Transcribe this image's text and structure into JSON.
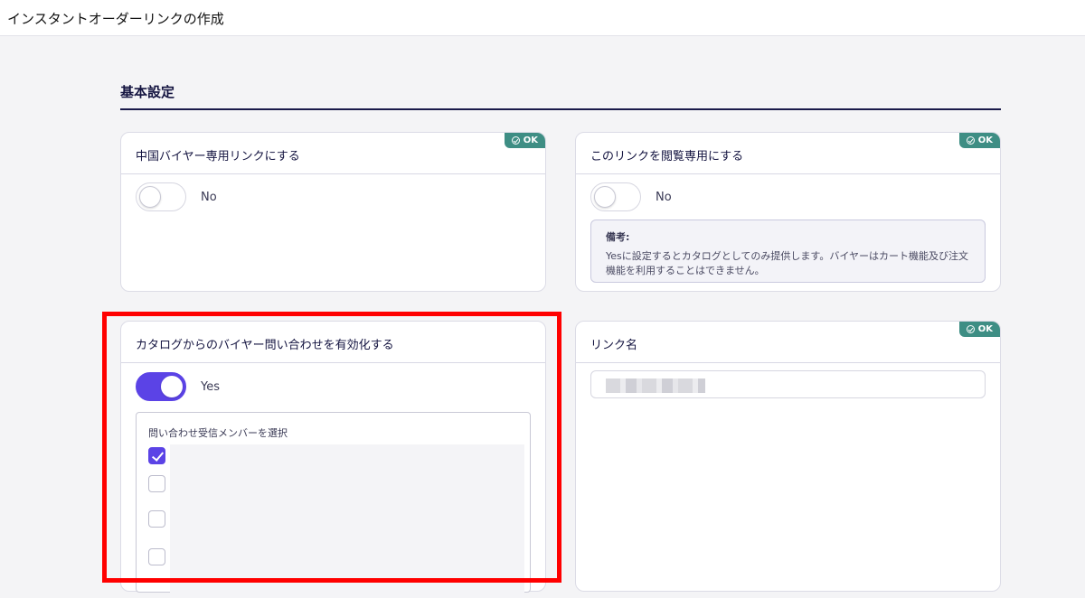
{
  "page_title": "インスタントオーダーリンクの作成",
  "section_title": "基本設定",
  "badge_ok": "OK",
  "cards": {
    "china_buyer": {
      "label": "中国バイヤー専用リンクにする",
      "toggle_state": "No"
    },
    "view_only": {
      "label": "このリンクを閲覧専用にする",
      "toggle_state": "No",
      "note_title": "備考:",
      "note_body": "Yesに設定するとカタログとしてのみ提供します。バイヤーはカート機能及び注文機能を利用することはできません。"
    },
    "catalog_inquiry": {
      "label": "カタログからのバイヤー問い合わせを有効化する",
      "toggle_state": "Yes",
      "member_title": "問い合わせ受信メンバーを選択",
      "members_checked": [
        true,
        false,
        false,
        false
      ]
    },
    "link_name": {
      "label": "リンク名"
    }
  },
  "colors": {
    "accent": "#5b43e6",
    "ok_badge": "#3e8e84",
    "highlight": "#ff0000",
    "section_rule": "#1a1a4a"
  },
  "icons": [
    "check-circle-icon",
    "checkbox-check-icon"
  ]
}
